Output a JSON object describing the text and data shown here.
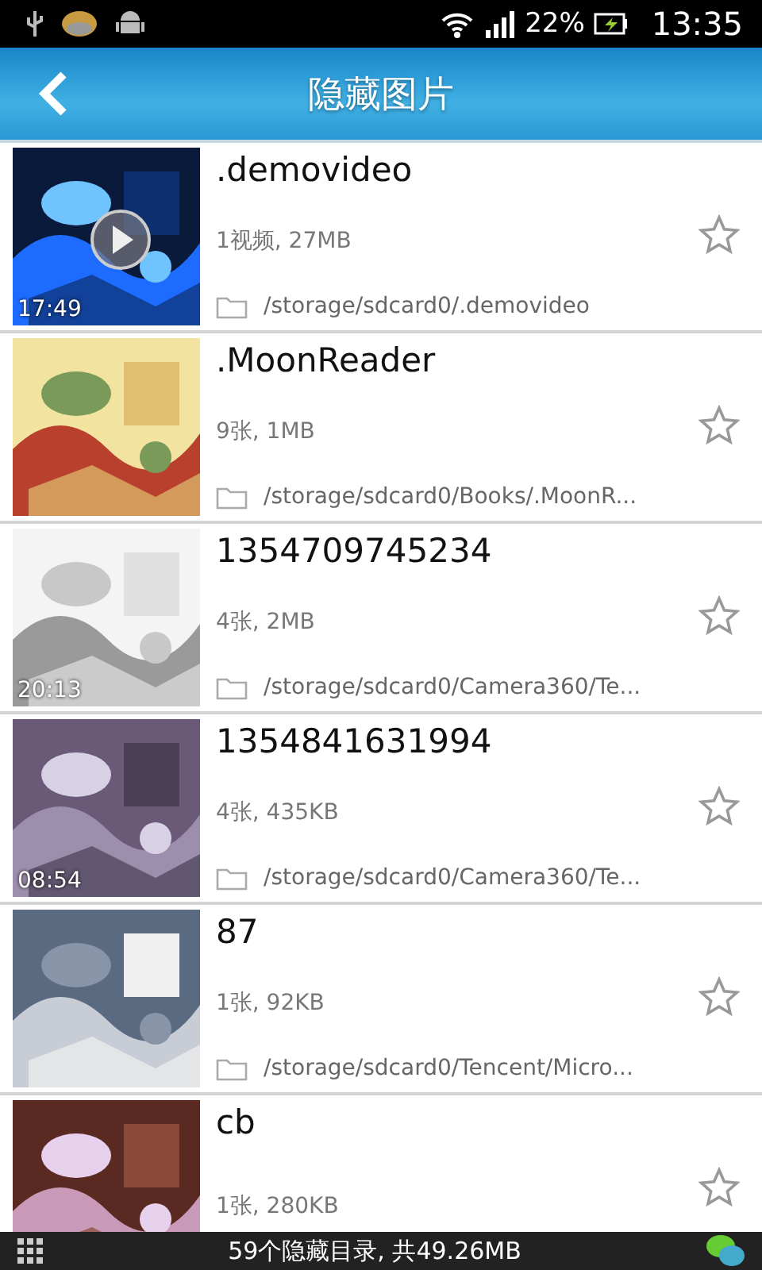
{
  "status_bar": {
    "battery": "22%",
    "time": "13:35"
  },
  "header": {
    "title": "隐藏图片"
  },
  "folders": [
    {
      "name": ".demovideo",
      "info": "1视频, 27MB",
      "path": "/storage/sdcard0/.demovideo",
      "duration": "17:49",
      "kind": "video"
    },
    {
      "name": ".MoonReader",
      "info": "9张, 1MB",
      "path": "/storage/sdcard0/Books/.MoonR..."
    },
    {
      "name": "1354709745234",
      "info": "4张, 2MB",
      "path": "/storage/sdcard0/Camera360/Te...",
      "duration": "20:13"
    },
    {
      "name": "1354841631994",
      "info": "4张, 435KB",
      "path": "/storage/sdcard0/Camera360/Te...",
      "duration": "08:54"
    },
    {
      "name": "87",
      "info": "1张, 92KB",
      "path": "/storage/sdcard0/Tencent/Micro..."
    },
    {
      "name": "cb",
      "info": "1张, 280KB"
    }
  ],
  "footer": {
    "summary": "59个隐藏目录, 共49.26MB"
  }
}
